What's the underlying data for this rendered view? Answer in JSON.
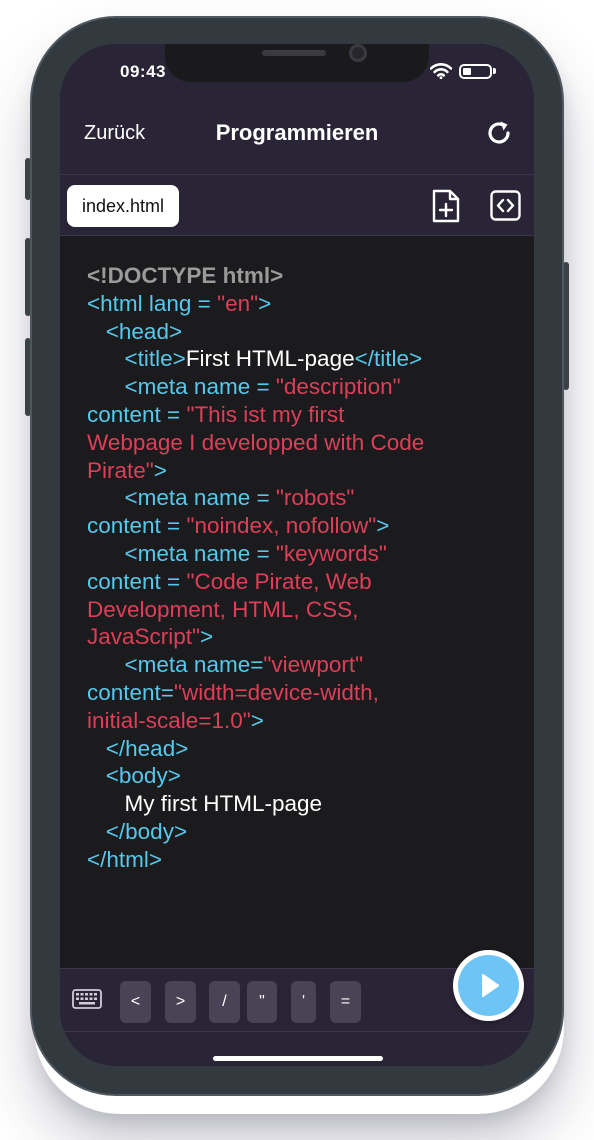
{
  "status_bar": {
    "time": "09:43"
  },
  "header": {
    "back_label": "Zurück",
    "title": "Programmieren"
  },
  "tabs": [
    {
      "label": "index.html",
      "active": true
    }
  ],
  "code_lines": [
    [
      {
        "t": "doctype",
        "s": "<!DOCTYPE html>"
      }
    ],
    [
      {
        "t": "tag",
        "s": "<html lang = "
      },
      {
        "t": "str",
        "s": "\"en\""
      },
      {
        "t": "tag",
        "s": ">"
      }
    ],
    [
      {
        "t": "tag",
        "s": "   <head>"
      }
    ],
    [
      {
        "t": "tag",
        "s": "      <title>"
      },
      {
        "t": "text",
        "s": "First HTML-page"
      },
      {
        "t": "tag",
        "s": "</title>"
      }
    ],
    [
      {
        "t": "tag",
        "s": "      <meta name = "
      },
      {
        "t": "str",
        "s": "\"description\""
      }
    ],
    [
      {
        "t": "tag",
        "s": "content = "
      },
      {
        "t": "str",
        "s": "\"This ist my first"
      }
    ],
    [
      {
        "t": "str",
        "s": "Webpage I developped with Code"
      }
    ],
    [
      {
        "t": "str",
        "s": "Pirate\""
      },
      {
        "t": "tag",
        "s": ">"
      }
    ],
    [
      {
        "t": "tag",
        "s": "      <meta name = "
      },
      {
        "t": "str",
        "s": "\"robots\""
      }
    ],
    [
      {
        "t": "tag",
        "s": "content = "
      },
      {
        "t": "str",
        "s": "\"noindex, nofollow\""
      },
      {
        "t": "tag",
        "s": ">"
      }
    ],
    [
      {
        "t": "tag",
        "s": "      <meta name = "
      },
      {
        "t": "str",
        "s": "\"keywords\""
      }
    ],
    [
      {
        "t": "tag",
        "s": "content = "
      },
      {
        "t": "str",
        "s": "\"Code Pirate, Web"
      }
    ],
    [
      {
        "t": "str",
        "s": "Development, HTML, CSS,"
      }
    ],
    [
      {
        "t": "str",
        "s": "JavaScript\""
      },
      {
        "t": "tag",
        "s": ">"
      }
    ],
    [
      {
        "t": "tag",
        "s": "      <meta name="
      },
      {
        "t": "str",
        "s": "\"viewport\""
      }
    ],
    [
      {
        "t": "tag",
        "s": "content="
      },
      {
        "t": "str",
        "s": "\"width=device-width,"
      }
    ],
    [
      {
        "t": "str",
        "s": "initial-scale=1.0\""
      },
      {
        "t": "tag",
        "s": ">"
      }
    ],
    [
      {
        "t": "tag",
        "s": "   </head>"
      }
    ],
    [
      {
        "t": "tag",
        "s": "   <body>"
      }
    ],
    [
      {
        "t": "text",
        "s": "      My first HTML-page"
      }
    ],
    [
      {
        "t": "tag",
        "s": "   </body>"
      }
    ],
    [
      {
        "t": "tag",
        "s": "</html>"
      }
    ]
  ],
  "keys": [
    "<",
    ">",
    "/",
    "\"",
    "'",
    "="
  ],
  "icons": {
    "refresh": "refresh-icon",
    "new_file": "new-file-icon",
    "code_view": "code-brackets-icon",
    "keyboard": "keyboard-icon",
    "run": "play-icon"
  },
  "colors": {
    "header_bg": "#2a2437",
    "editor_bg": "#1b1a1d",
    "tag": "#55c9ec",
    "string": "#dd3f58",
    "doctype": "#9a9a9a",
    "run_button": "#6ec4f4"
  }
}
